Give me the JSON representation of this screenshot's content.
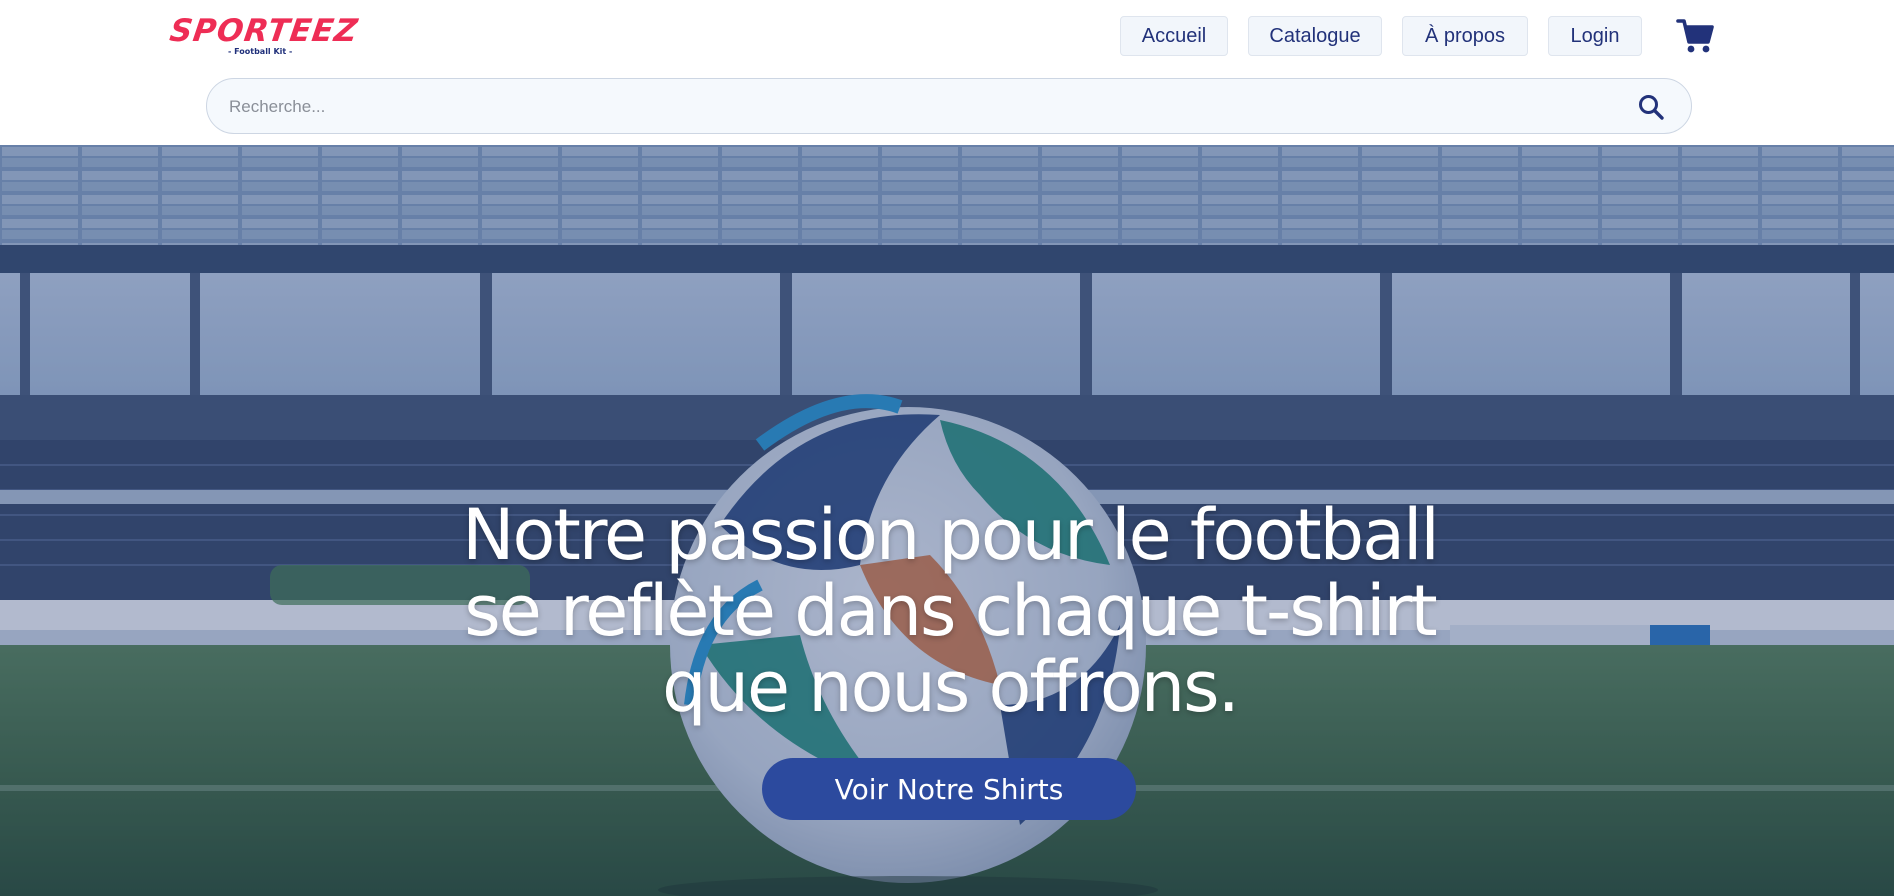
{
  "brand": {
    "name": "SPORTEEZ",
    "tagline": "- Football Kit -",
    "color": "#ee2d55"
  },
  "nav": {
    "items": [
      {
        "label": "Accueil"
      },
      {
        "label": "Catalogue"
      },
      {
        "label": "À propos"
      },
      {
        "label": "Login"
      }
    ],
    "cart_icon": "cart-icon"
  },
  "search": {
    "placeholder": "Recherche...",
    "value": "",
    "icon": "search-icon"
  },
  "hero": {
    "title": "Notre passion pour le football se reflète dans chaque t-shirt que nous offrons.",
    "cta_label": "Voir Notre Shirts",
    "background": "stadium-with-football-image"
  },
  "colors": {
    "accent": "#2c4a9e",
    "nav_text": "#22327a",
    "nav_bg": "#f2f6fb"
  }
}
